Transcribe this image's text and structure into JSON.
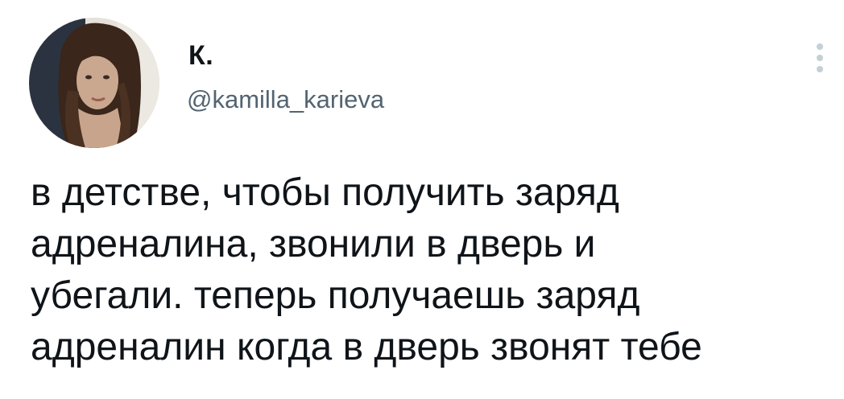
{
  "author": {
    "display_name": "К.",
    "handle": "@kamilla_karieva",
    "avatar_icon": "profile-photo"
  },
  "menu": {
    "icon": "more-vertical-icon"
  },
  "tweet": {
    "lines": [
      "в детстве, чтобы получить заряд",
      "адреналина, звонили в дверь и",
      "убегали. теперь получаешь заряд",
      "адреналин когда в дверь звонят тебе"
    ]
  },
  "colors": {
    "text": "#0f1419",
    "secondary": "#536471",
    "menu_dots": "#c4cfd6",
    "background": "#ffffff"
  }
}
